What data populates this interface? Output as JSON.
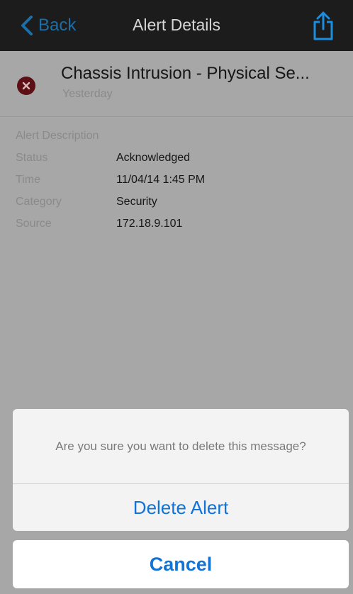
{
  "navbar": {
    "back_label": "Back",
    "title": "Alert Details",
    "share_icon": "share-icon"
  },
  "alert": {
    "icon": "error-icon",
    "title": "Chassis Intrusion - Physical Se...",
    "date": "Yesterday",
    "section_label": "Alert Description",
    "fields": [
      {
        "label": "Status",
        "value": "Acknowledged"
      },
      {
        "label": "Time",
        "value": "11/04/14 1:45 PM"
      },
      {
        "label": "Category",
        "value": "Security"
      },
      {
        "label": "Source",
        "value": "172.18.9.101"
      }
    ]
  },
  "action_sheet": {
    "message": "Are you sure you want to delete this message?",
    "delete_label": "Delete Alert",
    "cancel_label": "Cancel"
  },
  "colors": {
    "accent": "#1272d6",
    "navbar": "#1c1c1c",
    "dim_overlay": "#a7a7a7",
    "error": "#5c0f14"
  }
}
